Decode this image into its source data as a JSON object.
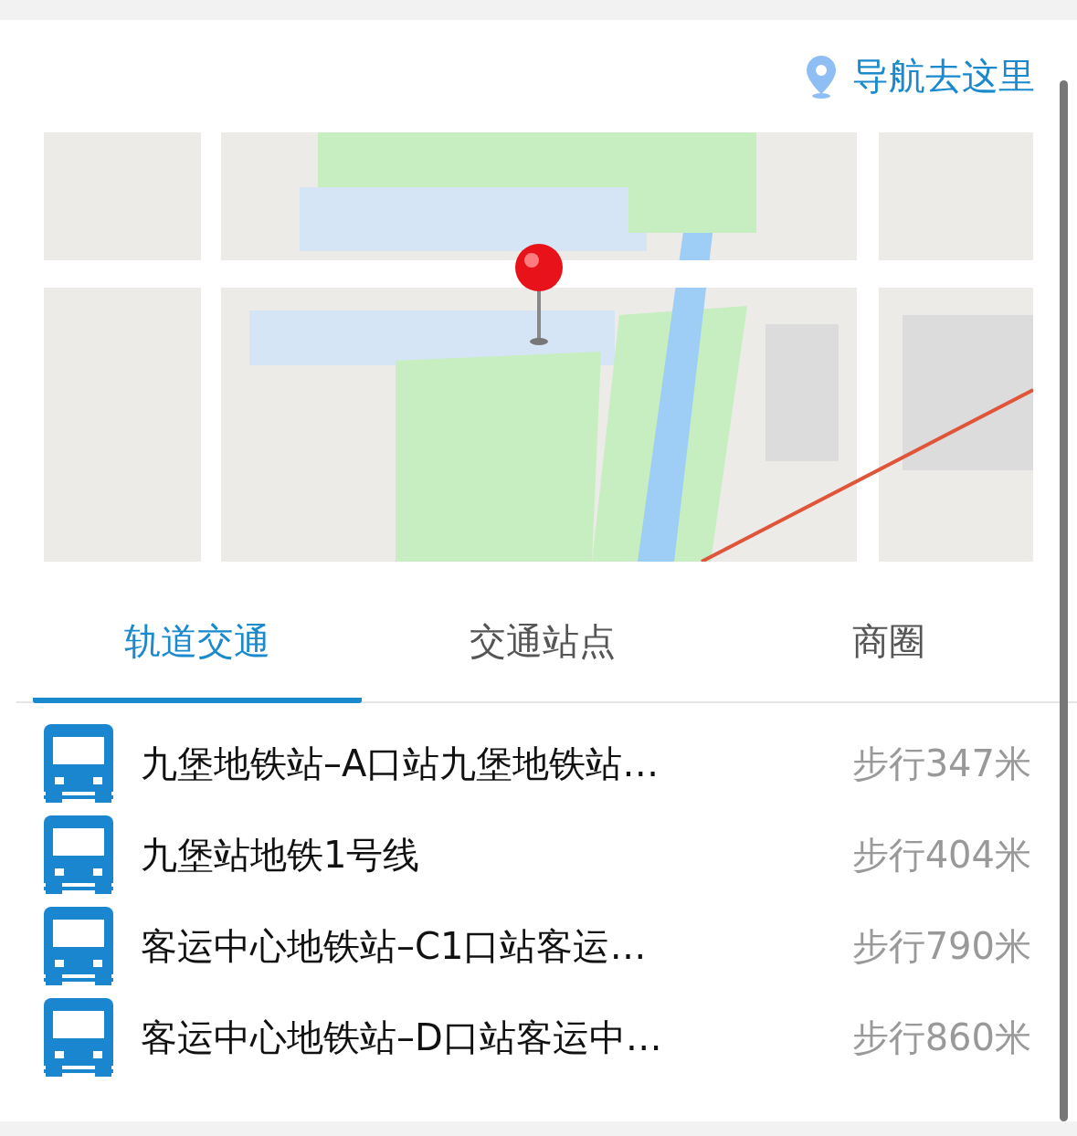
{
  "navigate_link": {
    "label": "导航去这里"
  },
  "tabs": [
    {
      "label": "轨道交通",
      "selected": true
    },
    {
      "label": "交通站点",
      "selected": false
    },
    {
      "label": "商圈",
      "selected": false
    }
  ],
  "stations": [
    {
      "name": "九堡地铁站–A口站九堡地铁站…",
      "distance": "步行347米"
    },
    {
      "name": "九堡站地铁1号线",
      "distance": "步行404米"
    },
    {
      "name": "客运中心地铁站–C1口站客运…",
      "distance": "步行790米"
    },
    {
      "name": "客运中心地铁站–D口站客运中…",
      "distance": "步行860米"
    }
  ]
}
